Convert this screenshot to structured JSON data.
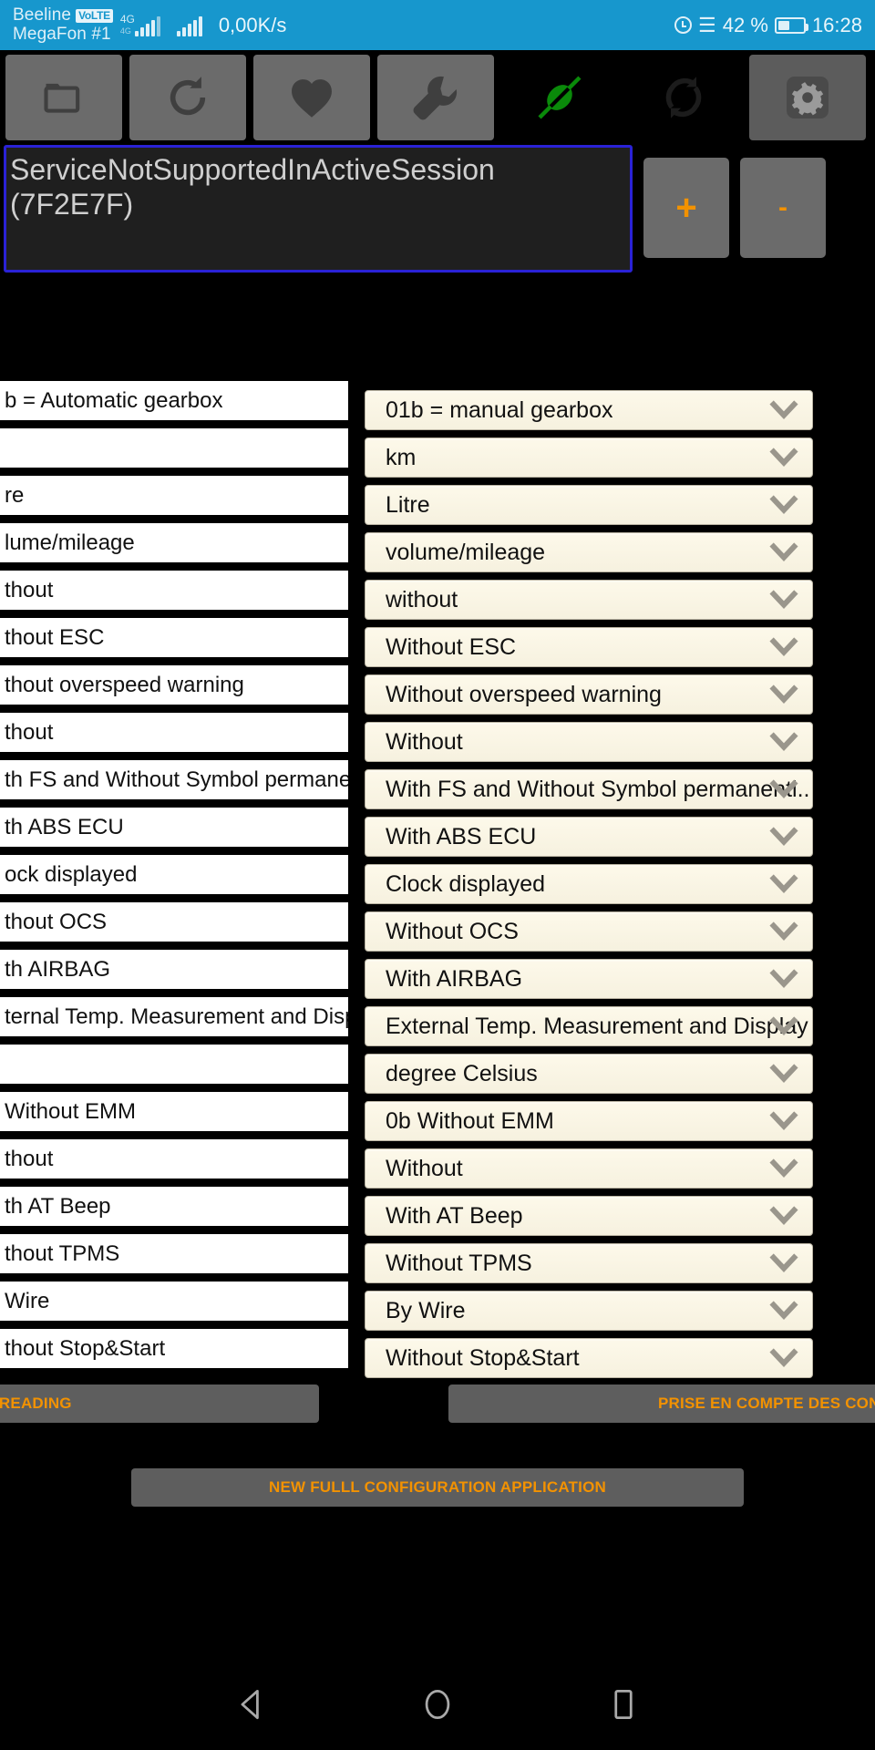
{
  "statusbar": {
    "carrier1": "Beeline",
    "volte_badge": "VoLTE",
    "carrier2": "MegaFon #1",
    "network_type": "4G",
    "network_type2": "4G",
    "net_speed": "0,00K/s",
    "battery_percent": "42 %",
    "clock": "16:28",
    "icons": [
      "alarm-icon",
      "bluetooth-icon",
      "battery-icon"
    ],
    "bg_color": "#1797cd"
  },
  "toolbar": {
    "buttons": [
      {
        "name": "folder-open-button",
        "icon": "folder-icon",
        "has_bg": true,
        "color": "#3f3f3f"
      },
      {
        "name": "refresh-button",
        "icon": "refresh-icon",
        "has_bg": true,
        "color": "#3f3f3f"
      },
      {
        "name": "favorites-button",
        "icon": "heart-icon",
        "has_bg": true,
        "color": "#3f3f3f"
      },
      {
        "name": "tools-button",
        "icon": "wrench-icon",
        "has_bg": true,
        "color": "#3f3f3f"
      },
      {
        "name": "connection-button",
        "icon": "plug-icon",
        "has_bg": false,
        "color": "#0a8a0a"
      },
      {
        "name": "sync-button",
        "icon": "sync-icon",
        "has_bg": false,
        "color": "#1a1a1a"
      },
      {
        "name": "settings-button",
        "icon": "gear-icon",
        "has_bg": true,
        "color": "#4a4a4a"
      }
    ]
  },
  "message": {
    "text": "ServiceNotSupportedInActiveSession (7F2E7F)",
    "line1": "ServiceNotSupportedInActiveSession",
    "line2": "(7F2E7F)",
    "border_color": "#2a22d6",
    "plus_label": "+",
    "minus_label": "-",
    "accent": "#f39200"
  },
  "config_list": {
    "left_column": [
      "b = Automatic gearbox",
      "",
      "re",
      "lume/mileage",
      "thout",
      "thout ESC",
      "thout overspeed warning",
      "thout",
      "th FS and Without Symbol permanently",
      "th ABS ECU",
      "ock displayed",
      "thout OCS",
      "th AIRBAG",
      "ternal Temp. Measurement and Display",
      "",
      " Without EMM",
      "thout",
      "th AT Beep",
      "thout TPMS",
      " Wire",
      "thout Stop&Start"
    ],
    "right_column": [
      "01b = manual gearbox",
      "km",
      "Litre",
      "volume/mileage",
      "without",
      "Without ESC",
      "Without overspeed warning",
      "Without",
      "With FS and Without Symbol permanentl..",
      "With ABS ECU",
      "Clock displayed",
      "Without OCS",
      "With AIRBAG",
      "External Temp. Measurement and Display",
      "degree Celsius",
      "0b Without EMM",
      "Without",
      "With AT Beep",
      "Without TPMS",
      "By Wire",
      "Without Stop&Start"
    ]
  },
  "actions": {
    "read_button": "GURATION READING",
    "apply_button": "PRISE EN COMPTE DES CONFIGURAT",
    "full_button": "NEW FULLL CONFIGURATION APPLICATION",
    "text_color": "#f39200"
  },
  "navbar": {
    "back": "back-icon",
    "home": "home-icon",
    "recents": "recents-icon"
  }
}
